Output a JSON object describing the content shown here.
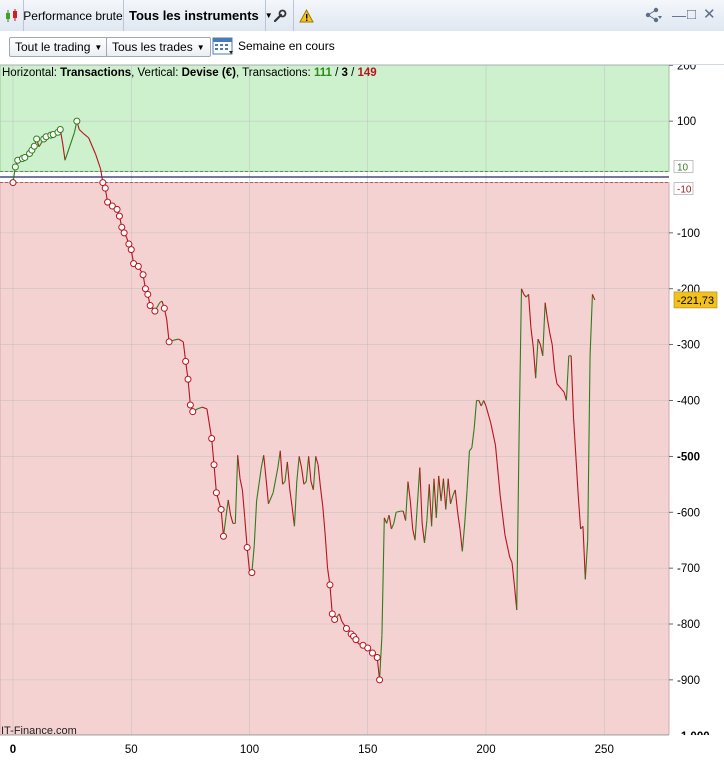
{
  "header": {
    "tab_performance": "Performance brute",
    "tab_instruments": "Tous les instruments"
  },
  "toolbar": {
    "trading_select": "Tout le trading",
    "trades_select": "Tous les trades",
    "period_label": "Semaine en cours"
  },
  "legend": {
    "horizontal_prefix": "Horizontal: ",
    "horizontal_value": "Transactions",
    "vertical_prefix": ", Vertical: ",
    "vertical_value": "Devise (€)",
    "transactions_prefix": ", Transactions: ",
    "wins": "111",
    "sep1": " / ",
    "neutral": "3",
    "sep2": " / ",
    "losses": "149"
  },
  "watermark": "IT-Finance.com",
  "last_value_label": "-221,73",
  "colors": {
    "profit_zone": "#cdf0cd",
    "loss_zone": "#f5d2d2",
    "up_line": "#2e7d1a",
    "down_line": "#b8141e",
    "last_value_bg": "#f2c11d"
  },
  "chart_data": {
    "type": "line",
    "title": "",
    "xlabel": "Transactions",
    "ylabel": "Devise (€)",
    "xlim": [
      0,
      277
    ],
    "ylim": [
      -1000,
      200
    ],
    "x_ticks": [
      0,
      50,
      100,
      150,
      200,
      250
    ],
    "y_ticks": [
      200,
      100,
      0,
      -100,
      -200,
      -300,
      -400,
      -500,
      -600,
      -700,
      -800,
      -900,
      -1000
    ],
    "y_tick_labels": [
      "200",
      "100",
      "0",
      "-100",
      "-200",
      "-300",
      "-400",
      "-500",
      "-600",
      "-700",
      "-800",
      "-900",
      "-1 000"
    ],
    "bold_y_ticks": [
      -500,
      -1000
    ],
    "threshold_labels": [
      "10",
      "-10"
    ],
    "grid": true,
    "series": [
      {
        "values": [
          [
            0,
            -10
          ],
          [
            1,
            18
          ],
          [
            2,
            30
          ],
          [
            4,
            33
          ],
          [
            5,
            35
          ],
          [
            7,
            42
          ],
          [
            8,
            48
          ],
          [
            9,
            55
          ],
          [
            10,
            68
          ],
          [
            11,
            54
          ],
          [
            13,
            68
          ],
          [
            14,
            72
          ],
          [
            16,
            75
          ],
          [
            17,
            76
          ],
          [
            19,
            80
          ],
          [
            20,
            85
          ],
          [
            21,
            60
          ],
          [
            22,
            30
          ],
          [
            24,
            55
          ],
          [
            26,
            80
          ],
          [
            27,
            100
          ],
          [
            28,
            85
          ],
          [
            30,
            77
          ],
          [
            32,
            70
          ],
          [
            35,
            40
          ],
          [
            37,
            15
          ],
          [
            38,
            -10
          ],
          [
            39,
            -20
          ],
          [
            40,
            -45
          ],
          [
            42,
            -52
          ],
          [
            44,
            -58
          ],
          [
            45,
            -70
          ],
          [
            46,
            -90
          ],
          [
            47,
            -100
          ],
          [
            48,
            -108
          ],
          [
            49,
            -120
          ],
          [
            50,
            -130
          ],
          [
            51,
            -155
          ],
          [
            53,
            -160
          ],
          [
            55,
            -175
          ],
          [
            56,
            -200
          ],
          [
            57,
            -210
          ],
          [
            58,
            -230
          ],
          [
            60,
            -240
          ],
          [
            62,
            -225
          ],
          [
            63,
            -222
          ],
          [
            64,
            -235
          ],
          [
            65,
            -255
          ],
          [
            66,
            -295
          ],
          [
            68,
            -292
          ],
          [
            70,
            -290
          ],
          [
            72,
            -295
          ],
          [
            73,
            -330
          ],
          [
            74,
            -362
          ],
          [
            75,
            -408
          ],
          [
            76,
            -420
          ],
          [
            78,
            -415
          ],
          [
            80,
            -412
          ],
          [
            82,
            -415
          ],
          [
            84,
            -468
          ],
          [
            85,
            -515
          ],
          [
            86,
            -565
          ],
          [
            88,
            -595
          ],
          [
            89,
            -643
          ],
          [
            90,
            -610
          ],
          [
            91,
            -578
          ],
          [
            92,
            -605
          ],
          [
            93,
            -620
          ],
          [
            94,
            -620
          ],
          [
            95,
            -498
          ],
          [
            96,
            -540
          ],
          [
            97,
            -560
          ],
          [
            98,
            -610
          ],
          [
            99,
            -663
          ],
          [
            100,
            -705
          ],
          [
            101,
            -708
          ],
          [
            102,
            -660
          ],
          [
            103,
            -580
          ],
          [
            105,
            -520
          ],
          [
            106,
            -498
          ],
          [
            107,
            -540
          ],
          [
            108,
            -585
          ],
          [
            110,
            -565
          ],
          [
            112,
            -520
          ],
          [
            113,
            -490
          ],
          [
            114,
            -550
          ],
          [
            115,
            -545
          ],
          [
            116,
            -510
          ],
          [
            117,
            -558
          ],
          [
            118,
            -590
          ],
          [
            119,
            -625
          ],
          [
            120,
            -545
          ],
          [
            121,
            -500
          ],
          [
            122,
            -520
          ],
          [
            123,
            -550
          ],
          [
            124,
            -545
          ],
          [
            125,
            -500
          ],
          [
            126,
            -545
          ],
          [
            127,
            -560
          ],
          [
            128,
            -500
          ],
          [
            129,
            -515
          ],
          [
            130,
            -555
          ],
          [
            131,
            -590
          ],
          [
            132,
            -640
          ],
          [
            133,
            -700
          ],
          [
            134,
            -730
          ],
          [
            135,
            -782
          ],
          [
            136,
            -792
          ],
          [
            138,
            -782
          ],
          [
            139,
            -795
          ],
          [
            141,
            -808
          ],
          [
            142,
            -812
          ],
          [
            143,
            -818
          ],
          [
            144,
            -822
          ],
          [
            145,
            -828
          ],
          [
            146,
            -835
          ],
          [
            148,
            -838
          ],
          [
            150,
            -843
          ],
          [
            152,
            -852
          ],
          [
            154,
            -860
          ],
          [
            155,
            -900
          ],
          [
            156,
            -820
          ],
          [
            157,
            -610
          ],
          [
            158,
            -620
          ],
          [
            159,
            -605
          ],
          [
            160,
            -630
          ],
          [
            161,
            -620
          ],
          [
            162,
            -600
          ],
          [
            164,
            -598
          ],
          [
            165,
            -598
          ],
          [
            166,
            -615
          ],
          [
            167,
            -545
          ],
          [
            168,
            -580
          ],
          [
            169,
            -630
          ],
          [
            170,
            -650
          ],
          [
            172,
            -520
          ],
          [
            173,
            -620
          ],
          [
            174,
            -655
          ],
          [
            175,
            -615
          ],
          [
            176,
            -550
          ],
          [
            177,
            -625
          ],
          [
            178,
            -540
          ],
          [
            179,
            -610
          ],
          [
            180,
            -535
          ],
          [
            181,
            -580
          ],
          [
            182,
            -540
          ],
          [
            183,
            -595
          ],
          [
            184,
            -540
          ],
          [
            185,
            -585
          ],
          [
            186,
            -570
          ],
          [
            187,
            -560
          ],
          [
            188,
            -600
          ],
          [
            189,
            -630
          ],
          [
            190,
            -670
          ],
          [
            191,
            -620
          ],
          [
            192,
            -560
          ],
          [
            193,
            -490
          ],
          [
            194,
            -485
          ],
          [
            195,
            -450
          ],
          [
            196,
            -400
          ],
          [
            197,
            -400
          ],
          [
            198,
            -410
          ],
          [
            199,
            -400
          ],
          [
            200,
            -410
          ],
          [
            202,
            -440
          ],
          [
            204,
            -480
          ],
          [
            206,
            -570
          ],
          [
            208,
            -640
          ],
          [
            210,
            -680
          ],
          [
            211,
            -690
          ],
          [
            212,
            -730
          ],
          [
            213,
            -775
          ],
          [
            214,
            -460
          ],
          [
            215,
            -200
          ],
          [
            216,
            -210
          ],
          [
            217,
            -215
          ],
          [
            218,
            -210
          ],
          [
            219,
            -270
          ],
          [
            220,
            -305
          ],
          [
            221,
            -360
          ],
          [
            222,
            -290
          ],
          [
            223,
            -300
          ],
          [
            224,
            -320
          ],
          [
            225,
            -225
          ],
          [
            226,
            -255
          ],
          [
            227,
            -280
          ],
          [
            228,
            -300
          ],
          [
            229,
            -345
          ],
          [
            230,
            -370
          ],
          [
            231,
            -375
          ],
          [
            232,
            -380
          ],
          [
            233,
            -385
          ],
          [
            234,
            -400
          ],
          [
            235,
            -320
          ],
          [
            236,
            -320
          ],
          [
            237,
            -430
          ],
          [
            238,
            -500
          ],
          [
            239,
            -570
          ],
          [
            240,
            -630
          ],
          [
            241,
            -625
          ],
          [
            242,
            -720
          ],
          [
            243,
            -650
          ],
          [
            244,
            -320
          ],
          [
            245,
            -210
          ],
          [
            246,
            -220
          ]
        ],
        "markers_x": [
          0,
          1,
          2,
          4,
          5,
          7,
          8,
          9,
          10,
          13,
          14,
          16,
          17,
          19,
          20,
          27,
          38,
          39,
          40,
          42,
          44,
          45,
          46,
          47,
          49,
          50,
          51,
          53,
          55,
          56,
          57,
          58,
          60,
          64,
          66,
          73,
          74,
          75,
          76,
          84,
          85,
          86,
          88,
          89,
          99,
          101,
          134,
          135,
          136,
          141,
          143,
          144,
          145,
          148,
          150,
          152,
          154,
          155
        ]
      }
    ]
  }
}
